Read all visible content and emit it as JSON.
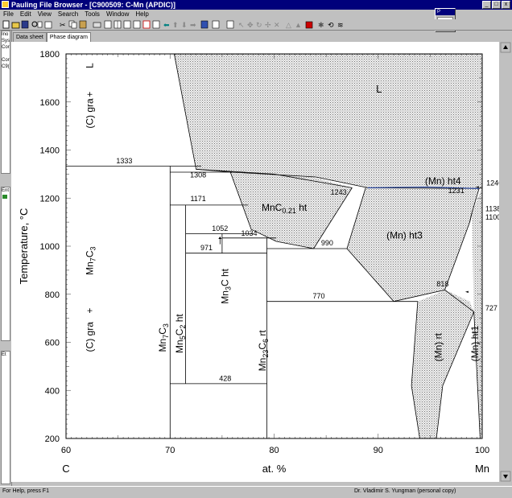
{
  "window": {
    "title": "Pauling File Browser - [C900509: C-Mn (APDIC)]",
    "controls": [
      "_",
      "□",
      "x"
    ]
  },
  "menu": [
    "File",
    "Edit",
    "View",
    "Search",
    "Tools",
    "Window",
    "Help"
  ],
  "mini_window": {
    "label": "C"
  },
  "left_panel": {
    "lines_top": [
      "Ino",
      "Sys",
      "Cor",
      "Cor",
      "C9("
    ],
    "lines_mid": [
      "Ent"
    ],
    "lines_bot": [
      "Et"
    ]
  },
  "tabs": [
    {
      "label": "Data sheet",
      "active": false
    },
    {
      "label": "Phase diagram",
      "active": true
    }
  ],
  "status": {
    "help": "For Help, press F1",
    "user": "Dr. Vladimir S. Yungman (personal copy)"
  },
  "chart_data": {
    "type": "phase_diagram",
    "xlabel": "at. %",
    "ylabel": "Temperature, °C",
    "x_left_element": "C",
    "x_right_element": "Mn",
    "xlim": [
      60,
      100
    ],
    "ylim": [
      200,
      1800
    ],
    "x_ticks": [
      "60",
      "70",
      "80",
      "90",
      "100"
    ],
    "y_ticks": [
      "200",
      "400",
      "600",
      "800",
      "1000",
      "1200",
      "1400",
      "1600",
      "1800"
    ],
    "temperature_labels": [
      "1333",
      "1308",
      "1171",
      "1052",
      "971",
      "1034",
      "1243",
      "990",
      "770",
      "818",
      "428",
      "1231",
      "1246",
      "1138",
      "1100",
      "727"
    ],
    "phase_labels": {
      "liquid": "L",
      "gra_l_1": "(C) gra",
      "gra_l_2": "+",
      "gra_l_3": "L",
      "gra_mn7_1": "(C) gra",
      "gra_mn7_2": "+",
      "gra_mn7_3": "Mn",
      "gra_mn7_sub": "7",
      "gra_mn7_4": "C",
      "gra_mn7_sub2": "3",
      "mn7c3_a": "Mn",
      "mn7c3_b": "7",
      "mn7c3_c": "C",
      "mn7c3_d": "3",
      "mn5c2_a": "Mn",
      "mn5c2_b": "5",
      "mn5c2_c": "C",
      "mn5c2_d": "2",
      "mn5c2_e": " ht",
      "mn3c_a": "Mn",
      "mn3c_b": "3",
      "mn3c_c": "C ht",
      "mn23c6_a": "Mn",
      "mn23c6_b": "23",
      "mn23c6_c": "C",
      "mn23c6_d": "6",
      "mn23c6_e": " rt",
      "mnc_a": "MnC",
      "mnc_b": "0.21",
      "mnc_c": " ht",
      "mn_ht3": "(Mn) ht3",
      "mn_ht4": "(Mn) ht4",
      "mn_rt": "(Mn) rt",
      "mn_ht1": "(Mn) ht1"
    },
    "grid": true
  }
}
